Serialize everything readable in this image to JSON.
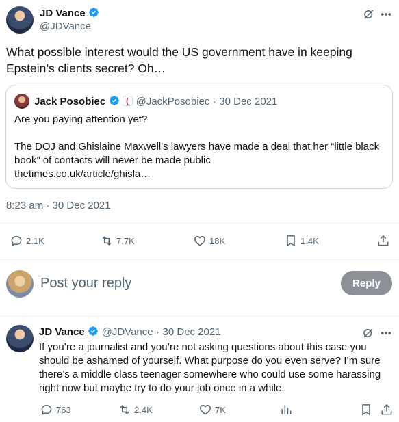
{
  "main_tweet": {
    "author_name": "JD Vance",
    "handle": "@JDVance",
    "text": "What possible interest would the US government have in keeping Epstein’s clients secret? Oh…",
    "timestamp": "8:23 am · 30 Dec 2021",
    "stats": {
      "replies": "2.1K",
      "retweets": "7.7K",
      "likes": "18K",
      "bookmarks": "1.4K"
    }
  },
  "quoted_tweet": {
    "author_name": "Jack Posobiec",
    "handle": "@JackPosobiec",
    "date": "30 Dec 2021",
    "line1": "Are you paying attention yet?",
    "line2": "The DOJ and Ghislaine Maxwell's lawyers have made a deal that her “little black book” of contacts will never be made public",
    "link": "thetimes.co.uk/article/ghisla…"
  },
  "reply_composer": {
    "placeholder": "Post your reply",
    "button_label": "Reply"
  },
  "reply_tweet": {
    "author_name": "JD Vance",
    "handle": "@JDVance",
    "date": "30 Dec 2021",
    "text": "If you’re a journalist and you’re not asking questions about this case you should be ashamed of yourself. What purpose do you even serve? I’m sure there’s a middle class teenager somewhere who could use some harassing right now but maybe try to do your job once in a while.",
    "stats": {
      "replies": "763",
      "retweets": "2.4K",
      "likes": "7K"
    }
  },
  "colors": {
    "verified_blue": "#1d9bf0",
    "secondary_text": "#536471",
    "divider": "#eff3f4",
    "reply_button_bg": "#8b9196"
  }
}
